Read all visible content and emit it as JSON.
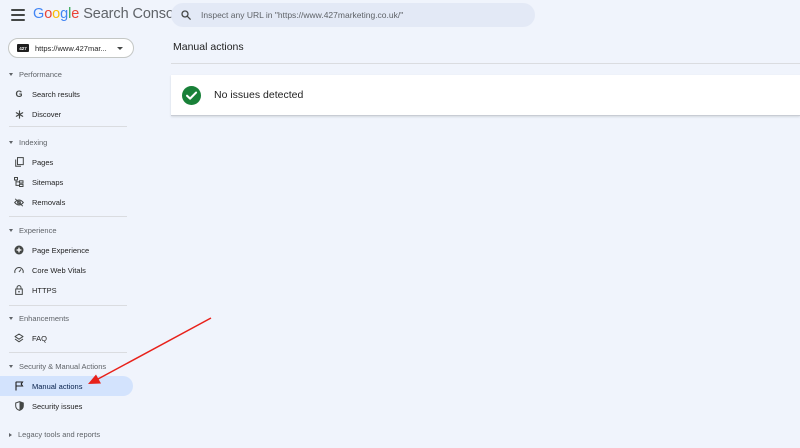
{
  "header": {
    "logo": {
      "G": "G",
      "o1": "o",
      "o2": "o",
      "g": "g",
      "l": "l",
      "e": "e",
      "product": "Search Console"
    },
    "search_placeholder": "Inspect any URL in \"https://www.427marketing.co.uk/\""
  },
  "property": {
    "logo_text": "427",
    "label": "https://www.427mar..."
  },
  "sidebar": {
    "performance": {
      "label": "Performance",
      "items": [
        "Search results",
        "Discover"
      ]
    },
    "indexing": {
      "label": "Indexing",
      "items": [
        "Pages",
        "Sitemaps",
        "Removals"
      ]
    },
    "experience": {
      "label": "Experience",
      "items": [
        "Page Experience",
        "Core Web Vitals",
        "HTTPS"
      ]
    },
    "enhancements": {
      "label": "Enhancements",
      "items": [
        "FAQ"
      ]
    },
    "security": {
      "label": "Security & Manual Actions",
      "items": [
        "Manual actions",
        "Security issues"
      ]
    },
    "legacy": {
      "label": "Legacy tools and reports"
    }
  },
  "main": {
    "title": "Manual actions",
    "status": "No issues detected"
  },
  "colors": {
    "accent": "#1a73e8",
    "active_bg": "#d3e3fd",
    "success": "#188038",
    "annotation_arrow": "#e8211a"
  }
}
